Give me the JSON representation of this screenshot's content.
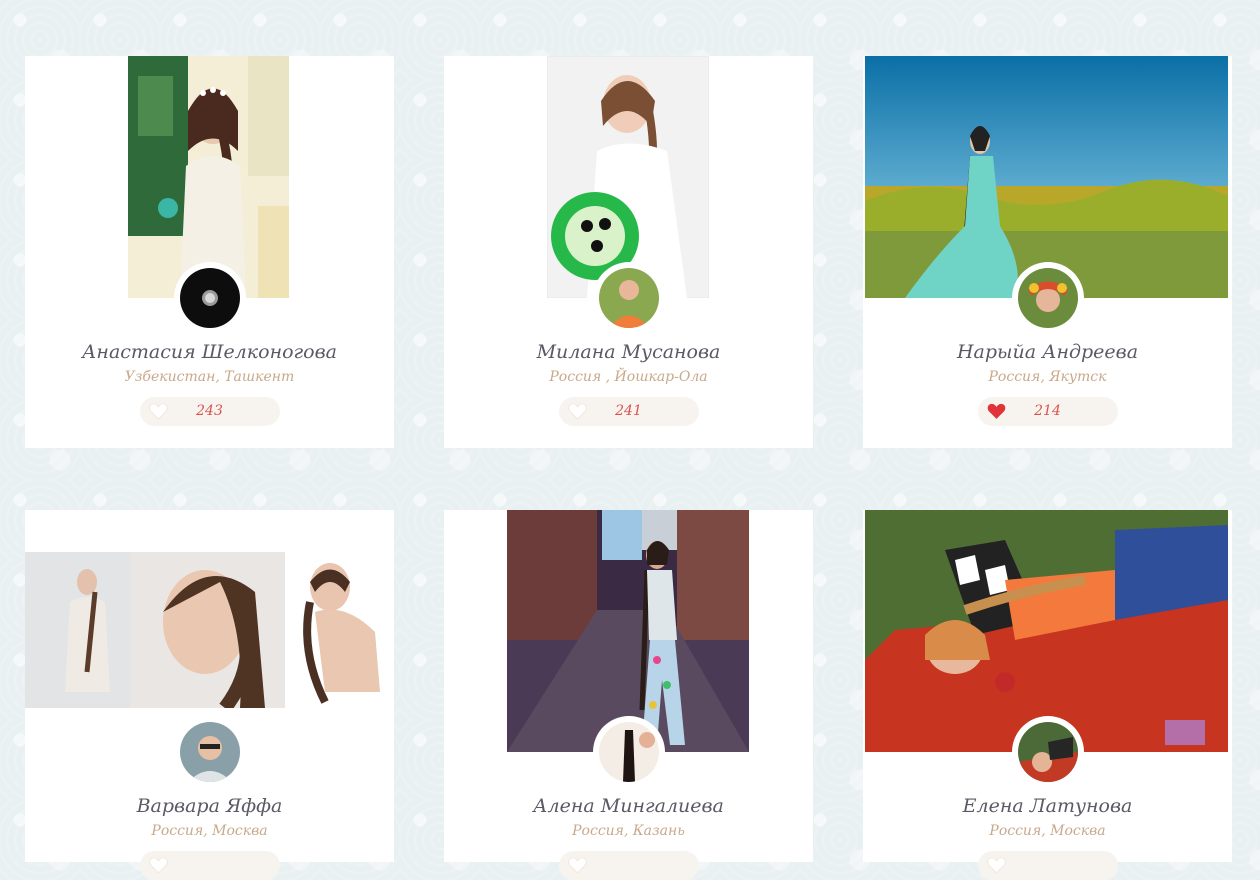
{
  "profiles": [
    {
      "name": "Анастасия Шелконогова",
      "location": "Узбекистан, Ташкент",
      "likes": "243",
      "liked": false
    },
    {
      "name": "Милана Мусанова",
      "location": "Россия , Йошкар-Ола",
      "likes": "241",
      "liked": false
    },
    {
      "name": "Нарыйа Андреева",
      "location": "Россия, Якутск",
      "likes": "214",
      "liked": true
    },
    {
      "name": "Варвара Яффа",
      "location": "Россия, Москва",
      "likes": "",
      "liked": false
    },
    {
      "name": "Алена Мингалиева",
      "location": "Россия, Казань",
      "likes": "",
      "liked": false
    },
    {
      "name": "Елена Латунова",
      "location": "Россия, Москва",
      "likes": "",
      "liked": false
    }
  ],
  "colors": {
    "heart_liked": "#e0343a",
    "heart_empty": "#ffffff",
    "name": "#5a5a66",
    "location": "#c8a98a",
    "count": "#d9534f"
  }
}
